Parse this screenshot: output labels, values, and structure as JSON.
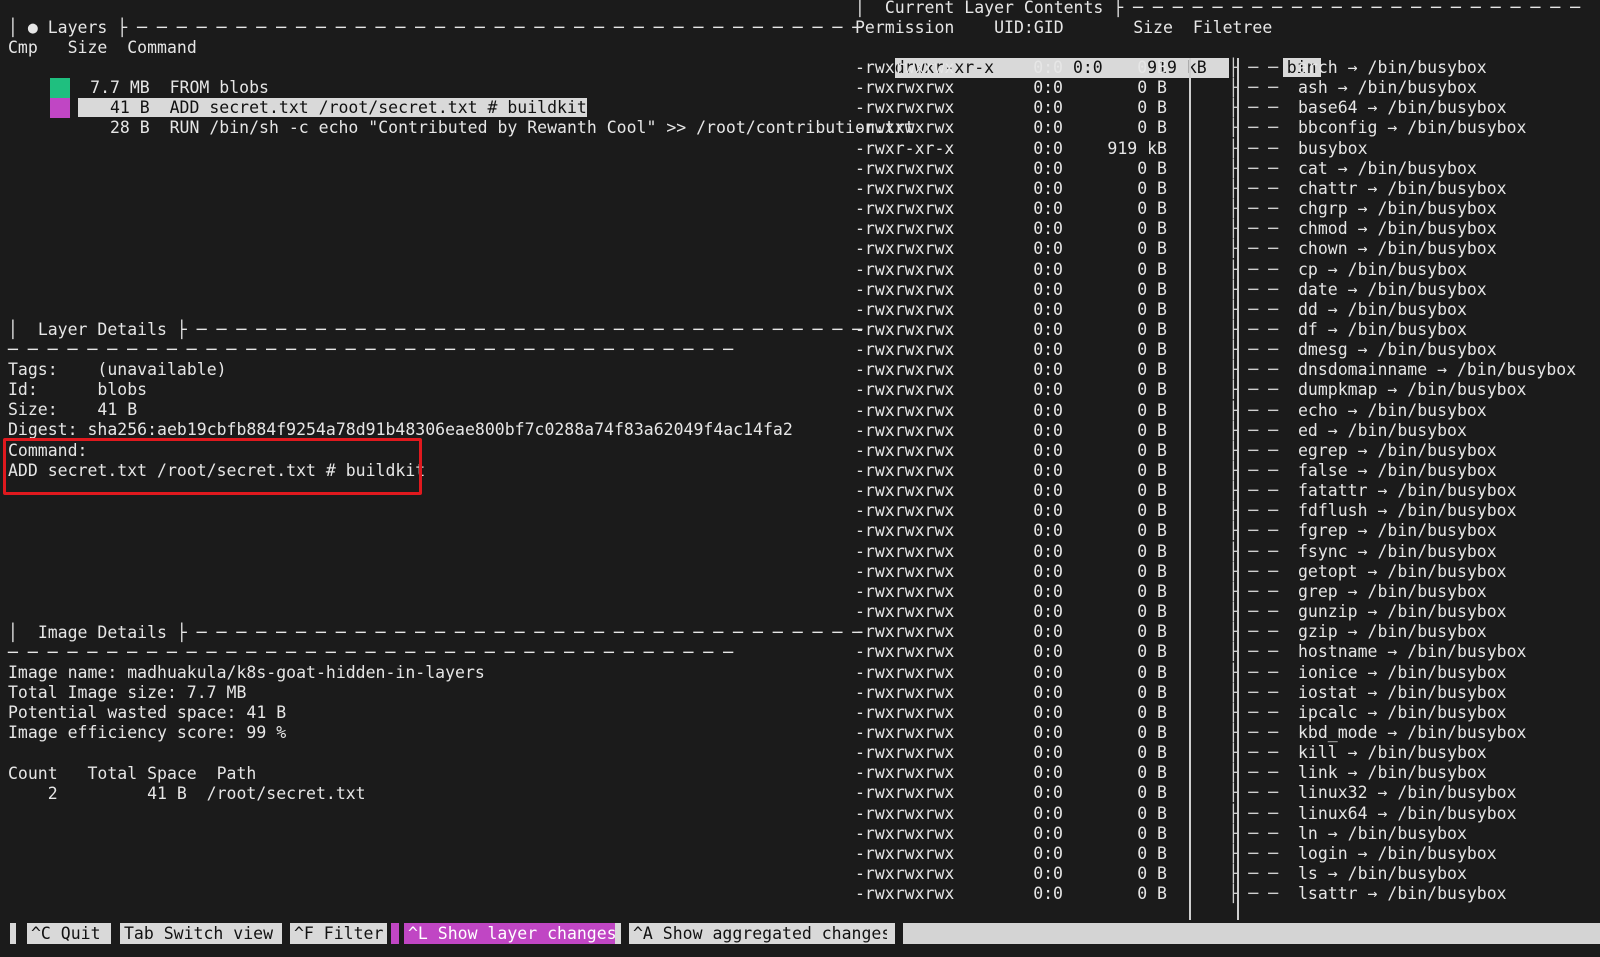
{
  "layers_panel": {
    "title": "Layers",
    "columns": {
      "cmp": "Cmp",
      "size": "Size",
      "command": "Command"
    },
    "rows": [
      {
        "color": "#1fbf7f",
        "size": "7.7 MB",
        "command": "FROM blobs"
      },
      {
        "color": "#c046c4",
        "size": "41 B",
        "command": "ADD secret.txt /root/secret.txt # buildkit"
      },
      {
        "color": "",
        "size": "28 B",
        "command": "RUN /bin/sh -c echo \"Contributed by Rewanth Cool\" >> /root/contribution.txt"
      }
    ]
  },
  "layer_details": {
    "title": "Layer Details",
    "tags_label": "Tags:",
    "tags": "(unavailable)",
    "id_label": "Id:",
    "id": "blobs",
    "size_label": "Size:",
    "size": "41 B",
    "digest_label": "Digest:",
    "digest": "sha256:aeb19cbfb884f9254a78d91b48306eae800bf7c0288a74f83a62049f4ac14fa2",
    "command_label": "Command:",
    "command": "ADD secret.txt /root/secret.txt # buildkit"
  },
  "image_details": {
    "title": "Image Details",
    "image_name": "Image name: madhuakula/k8s-goat-hidden-in-layers",
    "total_size": "Total Image size: 7.7 MB",
    "wasted": "Potential wasted space: 41 B",
    "efficiency": "Image efficiency score: 99 %",
    "table_header": "Count   Total Space  Path",
    "table_row": "    2         41 B  /root/secret.txt"
  },
  "contents_panel": {
    "title": "Current Layer Contents",
    "columns": {
      "permission": "Permission",
      "uidgid": "UID:GID",
      "size": "Size",
      "filetree": "Filetree"
    },
    "dir_row": {
      "perm": "drwxr-xr-x",
      "uid": "0:0",
      "size": "919 kB",
      "name": "bin"
    },
    "files": [
      {
        "perm": "-rwxrwxrwx",
        "uid": "0:0",
        "size": "0 B",
        "name": "arch → /bin/busybox"
      },
      {
        "perm": "-rwxrwxrwx",
        "uid": "0:0",
        "size": "0 B",
        "name": "ash → /bin/busybox"
      },
      {
        "perm": "-rwxrwxrwx",
        "uid": "0:0",
        "size": "0 B",
        "name": "base64 → /bin/busybox"
      },
      {
        "perm": "-rwxrwxrwx",
        "uid": "0:0",
        "size": "0 B",
        "name": "bbconfig → /bin/busybox"
      },
      {
        "perm": "-rwxr-xr-x",
        "uid": "0:0",
        "size": "919 kB",
        "name": "busybox"
      },
      {
        "perm": "-rwxrwxrwx",
        "uid": "0:0",
        "size": "0 B",
        "name": "cat → /bin/busybox"
      },
      {
        "perm": "-rwxrwxrwx",
        "uid": "0:0",
        "size": "0 B",
        "name": "chattr → /bin/busybox"
      },
      {
        "perm": "-rwxrwxrwx",
        "uid": "0:0",
        "size": "0 B",
        "name": "chgrp → /bin/busybox"
      },
      {
        "perm": "-rwxrwxrwx",
        "uid": "0:0",
        "size": "0 B",
        "name": "chmod → /bin/busybox"
      },
      {
        "perm": "-rwxrwxrwx",
        "uid": "0:0",
        "size": "0 B",
        "name": "chown → /bin/busybox"
      },
      {
        "perm": "-rwxrwxrwx",
        "uid": "0:0",
        "size": "0 B",
        "name": "cp → /bin/busybox"
      },
      {
        "perm": "-rwxrwxrwx",
        "uid": "0:0",
        "size": "0 B",
        "name": "date → /bin/busybox"
      },
      {
        "perm": "-rwxrwxrwx",
        "uid": "0:0",
        "size": "0 B",
        "name": "dd → /bin/busybox"
      },
      {
        "perm": "-rwxrwxrwx",
        "uid": "0:0",
        "size": "0 B",
        "name": "df → /bin/busybox"
      },
      {
        "perm": "-rwxrwxrwx",
        "uid": "0:0",
        "size": "0 B",
        "name": "dmesg → /bin/busybox"
      },
      {
        "perm": "-rwxrwxrwx",
        "uid": "0:0",
        "size": "0 B",
        "name": "dnsdomainname → /bin/busybox"
      },
      {
        "perm": "-rwxrwxrwx",
        "uid": "0:0",
        "size": "0 B",
        "name": "dumpkmap → /bin/busybox"
      },
      {
        "perm": "-rwxrwxrwx",
        "uid": "0:0",
        "size": "0 B",
        "name": "echo → /bin/busybox"
      },
      {
        "perm": "-rwxrwxrwx",
        "uid": "0:0",
        "size": "0 B",
        "name": "ed → /bin/busybox"
      },
      {
        "perm": "-rwxrwxrwx",
        "uid": "0:0",
        "size": "0 B",
        "name": "egrep → /bin/busybox"
      },
      {
        "perm": "-rwxrwxrwx",
        "uid": "0:0",
        "size": "0 B",
        "name": "false → /bin/busybox"
      },
      {
        "perm": "-rwxrwxrwx",
        "uid": "0:0",
        "size": "0 B",
        "name": "fatattr → /bin/busybox"
      },
      {
        "perm": "-rwxrwxrwx",
        "uid": "0:0",
        "size": "0 B",
        "name": "fdflush → /bin/busybox"
      },
      {
        "perm": "-rwxrwxrwx",
        "uid": "0:0",
        "size": "0 B",
        "name": "fgrep → /bin/busybox"
      },
      {
        "perm": "-rwxrwxrwx",
        "uid": "0:0",
        "size": "0 B",
        "name": "fsync → /bin/busybox"
      },
      {
        "perm": "-rwxrwxrwx",
        "uid": "0:0",
        "size": "0 B",
        "name": "getopt → /bin/busybox"
      },
      {
        "perm": "-rwxrwxrwx",
        "uid": "0:0",
        "size": "0 B",
        "name": "grep → /bin/busybox"
      },
      {
        "perm": "-rwxrwxrwx",
        "uid": "0:0",
        "size": "0 B",
        "name": "gunzip → /bin/busybox"
      },
      {
        "perm": "-rwxrwxrwx",
        "uid": "0:0",
        "size": "0 B",
        "name": "gzip → /bin/busybox"
      },
      {
        "perm": "-rwxrwxrwx",
        "uid": "0:0",
        "size": "0 B",
        "name": "hostname → /bin/busybox"
      },
      {
        "perm": "-rwxrwxrwx",
        "uid": "0:0",
        "size": "0 B",
        "name": "ionice → /bin/busybox"
      },
      {
        "perm": "-rwxrwxrwx",
        "uid": "0:0",
        "size": "0 B",
        "name": "iostat → /bin/busybox"
      },
      {
        "perm": "-rwxrwxrwx",
        "uid": "0:0",
        "size": "0 B",
        "name": "ipcalc → /bin/busybox"
      },
      {
        "perm": "-rwxrwxrwx",
        "uid": "0:0",
        "size": "0 B",
        "name": "kbd_mode → /bin/busybox"
      },
      {
        "perm": "-rwxrwxrwx",
        "uid": "0:0",
        "size": "0 B",
        "name": "kill → /bin/busybox"
      },
      {
        "perm": "-rwxrwxrwx",
        "uid": "0:0",
        "size": "0 B",
        "name": "link → /bin/busybox"
      },
      {
        "perm": "-rwxrwxrwx",
        "uid": "0:0",
        "size": "0 B",
        "name": "linux32 → /bin/busybox"
      },
      {
        "perm": "-rwxrwxrwx",
        "uid": "0:0",
        "size": "0 B",
        "name": "linux64 → /bin/busybox"
      },
      {
        "perm": "-rwxrwxrwx",
        "uid": "0:0",
        "size": "0 B",
        "name": "ln → /bin/busybox"
      },
      {
        "perm": "-rwxrwxrwx",
        "uid": "0:0",
        "size": "0 B",
        "name": "login → /bin/busybox"
      },
      {
        "perm": "-rwxrwxrwx",
        "uid": "0:0",
        "size": "0 B",
        "name": "ls → /bin/busybox"
      },
      {
        "perm": "-rwxrwxrwx",
        "uid": "0:0",
        "size": "0 B",
        "name": "lsattr → /bin/busybox"
      }
    ]
  },
  "status_bar": {
    "quit": "^C Quit",
    "switch": "Tab Switch view",
    "filter": "^F Filter",
    "layer_changes": "^L Show layer changes",
    "aggregated": "^A Show aggregated changes"
  },
  "colors": {
    "background": "#1b1b1b",
    "selection": "#d9d9d9",
    "accent": "#c046c4",
    "layer_green": "#1fbf7f",
    "highlight_box": "#e0191e"
  }
}
